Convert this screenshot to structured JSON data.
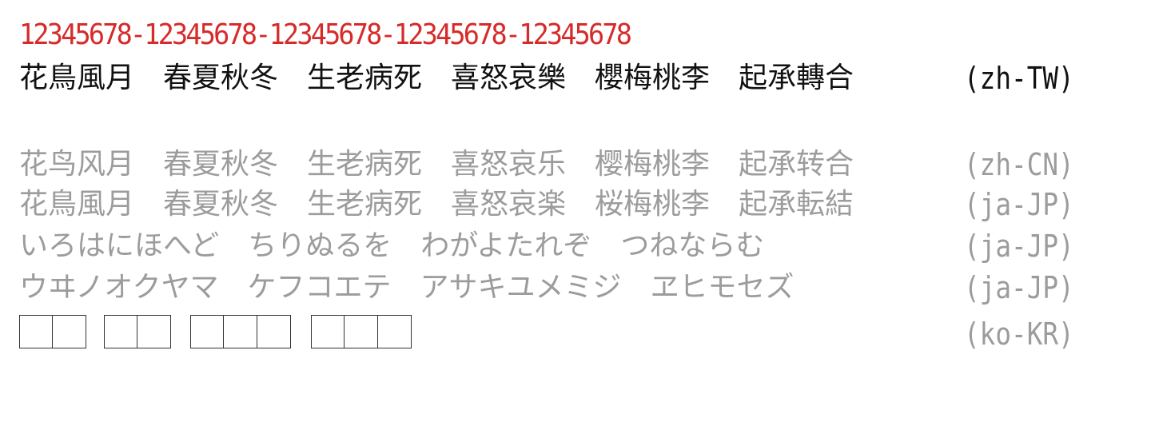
{
  "colors": {
    "digits": "#d62b2b",
    "primary": "#111111",
    "muted": "#9c9c9c",
    "box_border": "#333333"
  },
  "digits_line": "12345678-12345678-12345678-12345678-12345678",
  "rows": [
    {
      "text": "花鳥風月　春夏秋冬　生老病死　喜怒哀樂　櫻梅桃李　起承轉合",
      "tag": "(zh-TW)"
    },
    {
      "text": "花鸟风月　春夏秋冬　生老病死　喜怒哀乐　樱梅桃李　起承转合",
      "tag": "(zh-CN)"
    },
    {
      "text": "花鳥風月　春夏秋冬　生老病死　喜怒哀楽　桜梅桃李　起承転結",
      "tag": "(ja-JP)"
    },
    {
      "text": "いろはにほへど　ちりぬるを　わがよたれぞ　つねならむ",
      "tag": "(ja-JP)"
    },
    {
      "text": "ウヰノオクヤマ　ケフコエテ　アサキユメミジ　ヱヒモセズ",
      "tag": "(ja-JP)"
    },
    {
      "text": "",
      "tag": "(ko-KR)"
    }
  ],
  "ko_box_groups": [
    2,
    2,
    3,
    3
  ]
}
